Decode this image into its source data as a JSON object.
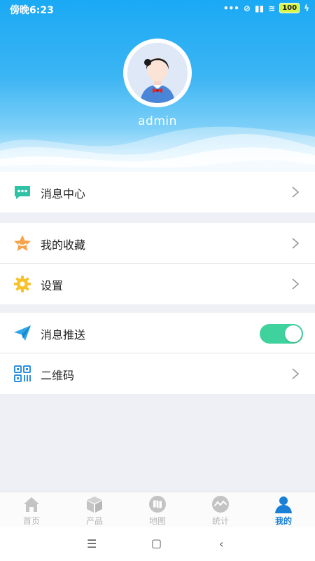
{
  "status_bar": {
    "time": "傍晚6:23",
    "battery": "100"
  },
  "profile": {
    "username": "admin"
  },
  "menu": {
    "message_center": "消息中心",
    "favorites": "我的收藏",
    "settings": "设置",
    "push_notifications": "消息推送",
    "push_enabled": true,
    "qr_code": "二维码"
  },
  "tabs": [
    {
      "label": "首页",
      "icon": "home-icon",
      "active": false
    },
    {
      "label": "产品",
      "icon": "box-icon",
      "active": false
    },
    {
      "label": "地图",
      "icon": "map-icon",
      "active": false
    },
    {
      "label": "统计",
      "icon": "stats-icon",
      "active": false
    },
    {
      "label": "我的",
      "icon": "user-icon",
      "active": true
    }
  ],
  "colors": {
    "header_top": "#1aa9f4",
    "toggle_on": "#40d29d",
    "tab_active": "#1a7fd6",
    "tab_inactive": "#b5b5b5"
  }
}
